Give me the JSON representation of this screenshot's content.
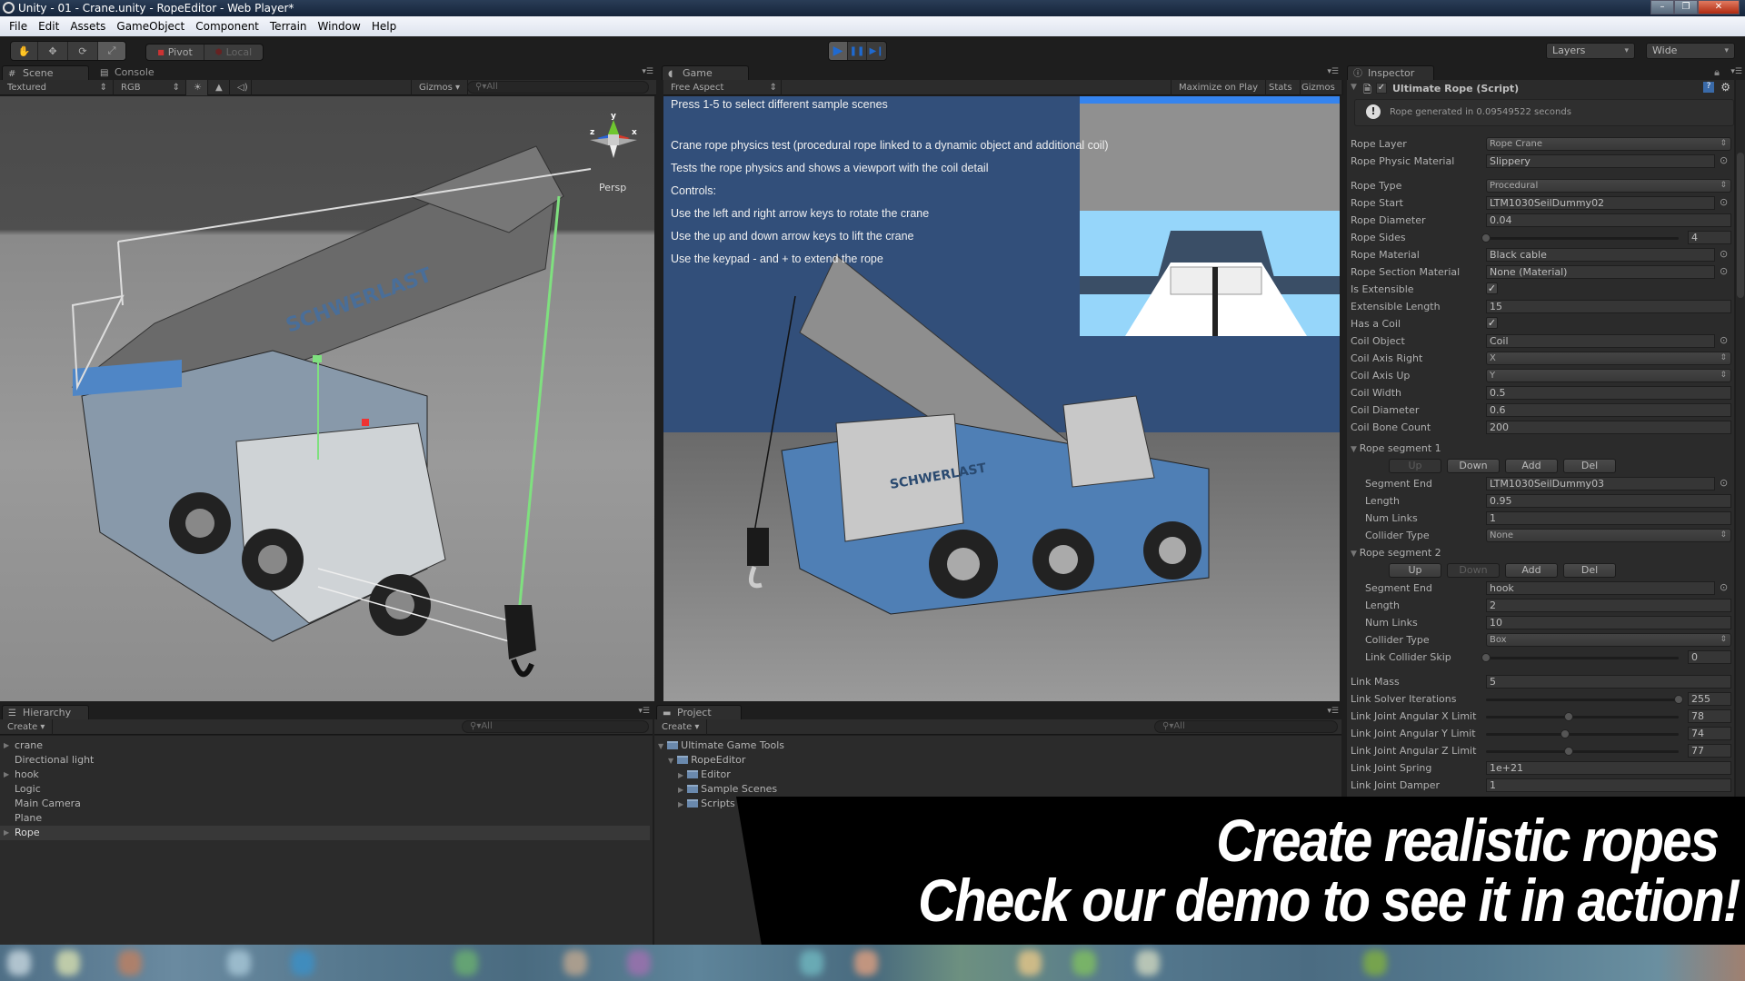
{
  "window": {
    "title": "Unity - 01 - Crane.unity - RopeEditor - Web Player*",
    "controls": {
      "minimize": "–",
      "maximize": "❐",
      "close": "✕"
    }
  },
  "menu": [
    "File",
    "Edit",
    "Assets",
    "GameObject",
    "Component",
    "Terrain",
    "Window",
    "Help"
  ],
  "toolbar": {
    "tools": [
      {
        "name": "hand-tool",
        "icon": "✋"
      },
      {
        "name": "move-tool",
        "icon": "✥"
      },
      {
        "name": "rotate-tool",
        "icon": "⟳"
      },
      {
        "name": "scale-tool",
        "icon": "⤢"
      }
    ],
    "pivot_label": "Pivot",
    "local_label": "Local",
    "play_icon": "▶",
    "pause_icon": "❚❚",
    "step_icon": "▶❙",
    "layers_label": "Layers",
    "layout_label": "Wide"
  },
  "scene_panel": {
    "tabs": [
      "Scene",
      "Console"
    ],
    "render_mode": "Textured",
    "color_mode": "RGB",
    "gizmos_label": "Gizmos",
    "search_placeholder": "All",
    "projection_label": "Persp",
    "axis_labels": {
      "x": "x",
      "y": "y",
      "z": "z"
    },
    "crane_text": "SCHWERLAST"
  },
  "game_panel": {
    "tab": "Game",
    "aspect": "Free Aspect",
    "maximize_label": "Maximize on Play",
    "stats_label": "Stats",
    "gizmos_label": "Gizmos",
    "overlay_lines": [
      "Press 1-5 to select different sample scenes",
      "Crane rope physics test (procedural rope linked to a dynamic object and additional coil)",
      "Tests the rope physics and shows a viewport with the coil detail",
      "Controls:",
      "Use the left and right arrow keys to rotate the crane",
      "Use the up and down arrow keys to lift the crane",
      "Use the keypad - and + to extend the rope"
    ],
    "crane_text": "SCHWERLAST"
  },
  "inspector": {
    "tab": "Inspector",
    "component_title": "Ultimate Rope (Script)",
    "info_message": "Rope generated in 0.09549522 seconds",
    "fields": [
      {
        "label": "Rope Layer",
        "type": "select",
        "value": "Rope Crane"
      },
      {
        "label": "Rope Physic Material",
        "type": "object",
        "value": "Slippery"
      },
      {
        "label": "Rope Type",
        "type": "select",
        "value": "Procedural"
      },
      {
        "label": "Rope Start",
        "type": "object",
        "value": "LTM1030SeilDummy02"
      },
      {
        "label": "Rope Diameter",
        "type": "text",
        "value": "0.04"
      },
      {
        "label": "Rope Sides",
        "type": "slider",
        "value": "4",
        "fraction": 0.0
      },
      {
        "label": "Rope Material",
        "type": "object",
        "value": "Black cable"
      },
      {
        "label": "Rope Section Material",
        "type": "object",
        "value": "None (Material)"
      },
      {
        "label": "Is Extensible",
        "type": "checkbox",
        "value": "✓"
      },
      {
        "label": "Extensible Length",
        "type": "text",
        "value": "15"
      },
      {
        "label": "Has a Coil",
        "type": "checkbox",
        "value": "✓"
      },
      {
        "label": "Coil Object",
        "type": "object",
        "value": "Coil"
      },
      {
        "label": "Coil Axis Right",
        "type": "select",
        "value": "X"
      },
      {
        "label": "Coil Axis Up",
        "type": "select",
        "value": "Y"
      },
      {
        "label": "Coil Width",
        "type": "text",
        "value": "0.5"
      },
      {
        "label": "Coil Diameter",
        "type": "text",
        "value": "0.6"
      },
      {
        "label": "Coil Bone Count",
        "type": "text",
        "value": "200"
      }
    ],
    "segments": [
      {
        "title": "Rope segment 1",
        "buttons": [
          {
            "label": "Up",
            "enabled": false
          },
          {
            "label": "Down",
            "enabled": true
          },
          {
            "label": "Add",
            "enabled": true
          },
          {
            "label": "Del",
            "enabled": true
          }
        ],
        "fields": [
          {
            "label": "Segment End",
            "type": "object",
            "value": "LTM1030SeilDummy03"
          },
          {
            "label": "Length",
            "type": "text",
            "value": "0.95"
          },
          {
            "label": "Num Links",
            "type": "text",
            "value": "1"
          },
          {
            "label": "Collider Type",
            "type": "select",
            "value": "None"
          }
        ]
      },
      {
        "title": "Rope segment 2",
        "buttons": [
          {
            "label": "Up",
            "enabled": true
          },
          {
            "label": "Down",
            "enabled": false
          },
          {
            "label": "Add",
            "enabled": true
          },
          {
            "label": "Del",
            "enabled": true
          }
        ],
        "fields": [
          {
            "label": "Segment End",
            "type": "object",
            "value": "hook"
          },
          {
            "label": "Length",
            "type": "text",
            "value": "2"
          },
          {
            "label": "Num Links",
            "type": "text",
            "value": "10"
          },
          {
            "label": "Collider Type",
            "type": "select",
            "value": "Box"
          },
          {
            "label": "Link Collider Skip",
            "type": "slider",
            "value": "0",
            "fraction": 0.0
          }
        ]
      }
    ],
    "link_fields": [
      {
        "label": "Link Mass",
        "type": "text",
        "value": "5"
      },
      {
        "label": "Link Solver Iterations",
        "type": "slider",
        "value": "255",
        "fraction": 1.0
      },
      {
        "label": "Link Joint Angular X Limit",
        "type": "slider",
        "value": "78",
        "fraction": 0.43
      },
      {
        "label": "Link Joint Angular Y Limit",
        "type": "slider",
        "value": "74",
        "fraction": 0.41
      },
      {
        "label": "Link Joint Angular Z Limit",
        "type": "slider",
        "value": "77",
        "fraction": 0.43
      },
      {
        "label": "Link Joint Spring",
        "type": "text",
        "value": "1e+21"
      },
      {
        "label": "Link Joint Damper",
        "type": "text",
        "value": "1"
      }
    ]
  },
  "hierarchy": {
    "tab": "Hierarchy",
    "create_label": "Create",
    "search_placeholder": "All",
    "items": [
      {
        "label": "crane",
        "expandable": true,
        "selected": false
      },
      {
        "label": "Directional light",
        "expandable": false,
        "selected": false
      },
      {
        "label": "hook",
        "expandable": true,
        "selected": false
      },
      {
        "label": "Logic",
        "expandable": false,
        "selected": false
      },
      {
        "label": "Main Camera",
        "expandable": false,
        "selected": false
      },
      {
        "label": "Plane",
        "expandable": false,
        "selected": false
      },
      {
        "label": "Rope",
        "expandable": true,
        "selected": true
      }
    ]
  },
  "project": {
    "tab": "Project",
    "create_label": "Create",
    "search_placeholder": "All",
    "items": [
      {
        "label": "Ultimate Game Tools",
        "depth": 0,
        "expanded": true
      },
      {
        "label": "RopeEditor",
        "depth": 1,
        "expanded": true
      },
      {
        "label": "Editor",
        "depth": 2,
        "expanded": false
      },
      {
        "label": "Sample Scenes",
        "depth": 2,
        "expanded": false
      },
      {
        "label": "Scripts",
        "depth": 2,
        "expanded": false
      }
    ]
  },
  "banner": {
    "line1": "Create realistic ropes",
    "line2": "Check our demo to see it in action!"
  },
  "colors": {
    "game_bg": "#324f7a",
    "play_blue": "#1f6ad0",
    "editor_bg": "#2b2b2b"
  }
}
